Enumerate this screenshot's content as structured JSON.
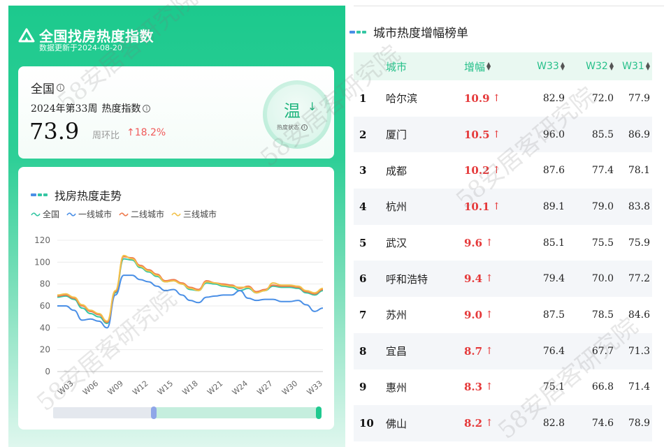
{
  "brand": {
    "title": "全国找房热度指数",
    "updated": "数据更新于2024-08-20"
  },
  "index_card": {
    "region": "全国",
    "week_label": "2024年第33周",
    "metric_label": "热度指数",
    "value": "73.9",
    "wow_label": "周环比",
    "wow_value": "18.2%",
    "status": "温",
    "status_label": "热度状态"
  },
  "trend": {
    "title": "找房热度走势",
    "zoom_range": [
      0.28,
      1.0
    ]
  },
  "chart_data": {
    "type": "line",
    "x": [
      "W01",
      "W02",
      "W03",
      "W04",
      "W05",
      "W06",
      "W07",
      "W08",
      "W09",
      "W10",
      "W11",
      "W12",
      "W13",
      "W14",
      "W15",
      "W16",
      "W17",
      "W18",
      "W19",
      "W20",
      "W21",
      "W22",
      "W23",
      "W24",
      "W25",
      "W26",
      "W27",
      "W28",
      "W29",
      "W30",
      "W31",
      "W32",
      "W33"
    ],
    "x_tick_labels": [
      "W03",
      "W06",
      "W09",
      "W12",
      "W15",
      "W18",
      "W21",
      "W24",
      "W27",
      "W30",
      "W33"
    ],
    "ylim": [
      0,
      120
    ],
    "y_ticks": [
      0,
      20,
      40,
      60,
      80,
      100,
      120
    ],
    "grid": true,
    "legend_position": "top-left",
    "series": [
      {
        "name": "全国",
        "color": "#34c6a3",
        "values": [
          68,
          69,
          66,
          58,
          53,
          50,
          44,
          72,
          103,
          102,
          95,
          91,
          87,
          82,
          83,
          80,
          75,
          74,
          81,
          80,
          78,
          77,
          74,
          76,
          72,
          74,
          78,
          77,
          77,
          76,
          72,
          70,
          74
        ]
      },
      {
        "name": "一线城市",
        "color": "#4a8fe6",
        "values": [
          60,
          60,
          56,
          47,
          48,
          46,
          40,
          70,
          88,
          88,
          84,
          82,
          78,
          74,
          75,
          70,
          65,
          63,
          68,
          69,
          70,
          70,
          74,
          67,
          65,
          66,
          66,
          64,
          64,
          65,
          61,
          55,
          58
        ]
      },
      {
        "name": "二线城市",
        "color": "#ee7a4d",
        "values": [
          69,
          70,
          67,
          60,
          55,
          52,
          45,
          73,
          105,
          104,
          97,
          93,
          89,
          83,
          84,
          81,
          77,
          75,
          83,
          81,
          80,
          79,
          76,
          78,
          73,
          75,
          79,
          78,
          78,
          77,
          73,
          71,
          75
        ]
      },
      {
        "name": "三线城市",
        "color": "#f2c24c",
        "values": [
          70,
          71,
          68,
          61,
          56,
          53,
          46,
          74,
          106,
          103,
          96,
          92,
          88,
          82,
          83,
          80,
          76,
          74,
          82,
          81,
          79,
          78,
          77,
          77,
          72,
          74,
          81,
          79,
          79,
          78,
          74,
          72,
          76
        ]
      }
    ]
  },
  "ranking": {
    "title": "城市热度增幅榜单",
    "headers": {
      "city": "城市",
      "increase": "增幅",
      "w33": "W33",
      "w32": "W32",
      "w31": "W31"
    },
    "rows": [
      {
        "rank": "1",
        "city": "哈尔滨",
        "inc": "10.9",
        "w33": "82.9",
        "w32": "72.0",
        "w31": "77.9"
      },
      {
        "rank": "2",
        "city": "厦门",
        "inc": "10.5",
        "w33": "96.0",
        "w32": "85.5",
        "w31": "86.9"
      },
      {
        "rank": "3",
        "city": "成都",
        "inc": "10.2",
        "w33": "87.6",
        "w32": "77.4",
        "w31": "78.1"
      },
      {
        "rank": "4",
        "city": "杭州",
        "inc": "10.1",
        "w33": "89.1",
        "w32": "79.0",
        "w31": "83.8"
      },
      {
        "rank": "5",
        "city": "武汉",
        "inc": "9.6",
        "w33": "85.1",
        "w32": "75.5",
        "w31": "75.9"
      },
      {
        "rank": "6",
        "city": "呼和浩特",
        "inc": "9.4",
        "w33": "79.4",
        "w32": "70.0",
        "w31": "77.2"
      },
      {
        "rank": "7",
        "city": "苏州",
        "inc": "9.0",
        "w33": "87.5",
        "w32": "78.5",
        "w31": "84.6"
      },
      {
        "rank": "8",
        "city": "宜昌",
        "inc": "8.7",
        "w33": "76.4",
        "w32": "67.7",
        "w31": "71.3"
      },
      {
        "rank": "9",
        "city": "惠州",
        "inc": "8.3",
        "w33": "75.1",
        "w32": "66.8",
        "w31": "71.4"
      },
      {
        "rank": "10",
        "city": "佛山",
        "inc": "8.2",
        "w33": "82.8",
        "w32": "74.6",
        "w31": "78.9"
      }
    ]
  },
  "watermarks": [
    "58安居客研究院",
    "58安居客研究院",
    "58安居客研究院",
    "58安居客研究院",
    "58安居客研究院"
  ],
  "colors": {
    "brand": "#1cc98d",
    "increase": "#e5393a",
    "header_text": "#27c08a"
  }
}
